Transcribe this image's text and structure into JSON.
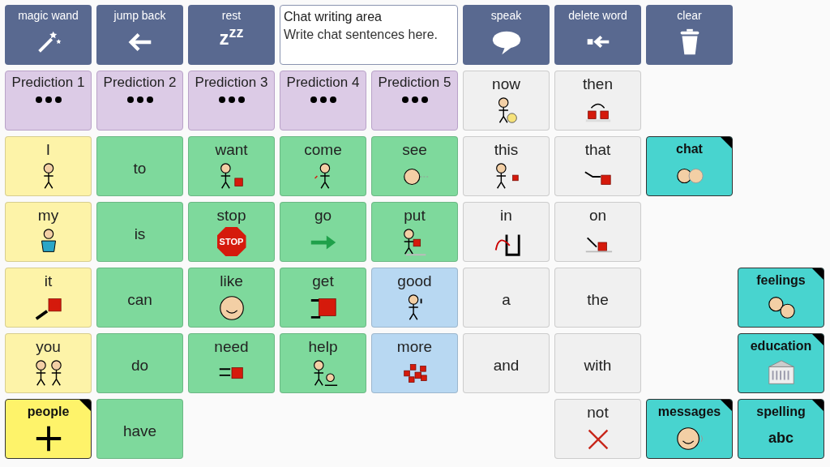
{
  "rows": [
    [
      {
        "kind": "action",
        "label": "magic wand"
      },
      {
        "kind": "action",
        "label": "jump back"
      },
      {
        "kind": "action",
        "label": "rest",
        "symbol": "z$^{z}$$^{z}$"
      },
      {
        "kind": "message_area",
        "title": "Chat writing area",
        "placeholder": "Write chat sentences here."
      },
      {
        "kind": "action",
        "label": "speak"
      },
      {
        "kind": "action",
        "label": "delete word"
      },
      {
        "kind": "action",
        "label": "clear"
      },
      {
        "kind": "empty"
      }
    ],
    [
      {
        "kind": "prediction",
        "label": "Prediction 1"
      },
      {
        "kind": "prediction",
        "label": "Prediction 2"
      },
      {
        "kind": "prediction",
        "label": "Prediction 3"
      },
      {
        "kind": "prediction",
        "label": "Prediction 4"
      },
      {
        "kind": "prediction",
        "label": "Prediction 5"
      },
      {
        "kind": "word",
        "label": "now",
        "color": "#f0f0f0"
      },
      {
        "kind": "word",
        "label": "then",
        "color": "#f0f0f0"
      },
      {
        "kind": "empty"
      },
      {
        "kind": "empty"
      }
    ],
    [
      {
        "kind": "word",
        "label": "I",
        "color": "#fdf3a8"
      },
      {
        "kind": "word",
        "label": "to",
        "color": "#7ed99c"
      },
      {
        "kind": "word",
        "label": "want",
        "color": "#7ed99c"
      },
      {
        "kind": "word",
        "label": "come",
        "color": "#7ed99c"
      },
      {
        "kind": "word",
        "label": "see",
        "color": "#7ed99c"
      },
      {
        "kind": "word",
        "label": "this",
        "color": "#f0f0f0"
      },
      {
        "kind": "word",
        "label": "that",
        "color": "#f0f0f0"
      },
      {
        "kind": "folder",
        "label": "chat",
        "color": "#48d4cf"
      },
      {
        "kind": "empty"
      }
    ],
    [
      {
        "kind": "word",
        "label": "my",
        "color": "#fdf3a8"
      },
      {
        "kind": "word",
        "label": "is",
        "color": "#7ed99c"
      },
      {
        "kind": "word",
        "label": "stop",
        "color": "#7ed99c",
        "symbol": "STOP"
      },
      {
        "kind": "word",
        "label": "go",
        "color": "#7ed99c"
      },
      {
        "kind": "word",
        "label": "put",
        "color": "#7ed99c"
      },
      {
        "kind": "word",
        "label": "in",
        "color": "#f0f0f0"
      },
      {
        "kind": "word",
        "label": "on",
        "color": "#f0f0f0"
      },
      {
        "kind": "empty"
      },
      {
        "kind": "empty"
      }
    ],
    [
      {
        "kind": "word",
        "label": "it",
        "color": "#fdf3a8"
      },
      {
        "kind": "word",
        "label": "can",
        "color": "#7ed99c"
      },
      {
        "kind": "word",
        "label": "like",
        "color": "#7ed99c"
      },
      {
        "kind": "word",
        "label": "get",
        "color": "#7ed99c"
      },
      {
        "kind": "word",
        "label": "good",
        "color": "#b8d8f2"
      },
      {
        "kind": "word",
        "label": "a",
        "color": "#f0f0f0"
      },
      {
        "kind": "word",
        "label": "the",
        "color": "#f0f0f0"
      },
      {
        "kind": "empty"
      },
      {
        "kind": "folder",
        "label": "feelings",
        "color": "#48d4cf"
      }
    ],
    [
      {
        "kind": "word",
        "label": "you",
        "color": "#fdf3a8"
      },
      {
        "kind": "word",
        "label": "do",
        "color": "#7ed99c"
      },
      {
        "kind": "word",
        "label": "need",
        "color": "#7ed99c"
      },
      {
        "kind": "word",
        "label": "help",
        "color": "#7ed99c"
      },
      {
        "kind": "word",
        "label": "more",
        "color": "#b8d8f2"
      },
      {
        "kind": "word",
        "label": "and",
        "color": "#f0f0f0"
      },
      {
        "kind": "word",
        "label": "with",
        "color": "#f0f0f0"
      },
      {
        "kind": "empty"
      },
      {
        "kind": "folder",
        "label": "education",
        "color": "#48d4cf"
      }
    ],
    [
      {
        "kind": "folder",
        "label": "people",
        "color": "#fef36a"
      },
      {
        "kind": "word",
        "label": "have",
        "color": "#7ed99c"
      },
      {
        "kind": "empty"
      },
      {
        "kind": "empty"
      },
      {
        "kind": "empty"
      },
      {
        "kind": "empty"
      },
      {
        "kind": "word",
        "label": "not",
        "color": "#f0f0f0"
      },
      {
        "kind": "folder",
        "label": "messages",
        "color": "#48d4cf"
      },
      {
        "kind": "folder",
        "label": "spelling",
        "color": "#48d4cf",
        "symbol": "abc"
      }
    ]
  ]
}
